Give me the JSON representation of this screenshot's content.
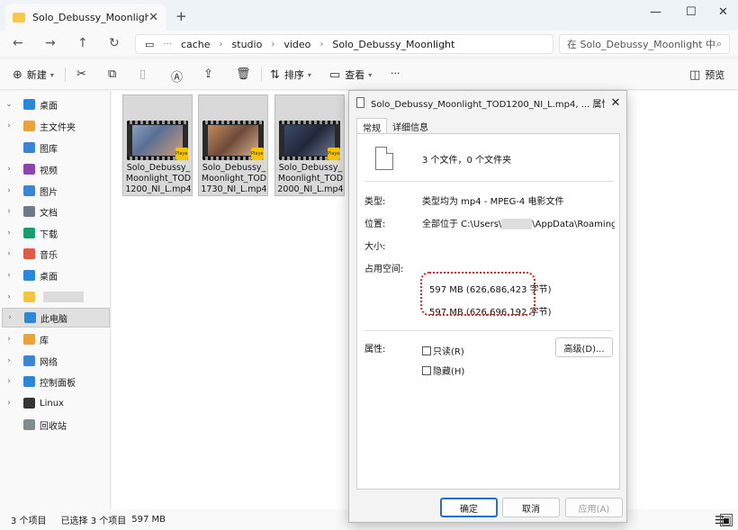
{
  "tab": {
    "title": "Solo_Debussy_Moonlight",
    "close": "✕",
    "new_tab": "+"
  },
  "window_controls": {
    "minimize": "—",
    "maximize": "☐",
    "close": "✕"
  },
  "address": {
    "back": "←",
    "forward": "→",
    "up": "↑",
    "refresh": "↻",
    "more": "···",
    "breadcrumbs": [
      "cache",
      "studio",
      "video",
      "Solo_Debussy_Moonlight"
    ],
    "search_placeholder": "在 Solo_Debussy_Moonlight 中搜索"
  },
  "toolbar": {
    "new": "新建",
    "sort": "排序",
    "view": "查看",
    "more": "···",
    "preview": "预览"
  },
  "sidebar": {
    "items": [
      {
        "label": "桌面",
        "expand": "⌄",
        "color": "#2b88d8"
      },
      {
        "label": "主文件夹",
        "expand": "›",
        "color": "#e8a33d"
      },
      {
        "label": "图库",
        "expand": "",
        "color": "#3a86d4"
      },
      {
        "label": "视频",
        "expand": "›",
        "color": "#8e44ad"
      },
      {
        "label": "图片",
        "expand": "›",
        "color": "#3a86d4"
      },
      {
        "label": "文档",
        "expand": "›",
        "color": "#6c7a89"
      },
      {
        "label": "下载",
        "expand": "›",
        "color": "#1a9c6e"
      },
      {
        "label": "音乐",
        "expand": "›",
        "color": "#e05a47"
      },
      {
        "label": "桌面",
        "expand": "›",
        "color": "#2b88d8"
      },
      {
        "label": "",
        "expand": "›",
        "color": "#f5c542"
      },
      {
        "label": "此电脑",
        "expand": "›",
        "color": "#2b88d8"
      },
      {
        "label": "库",
        "expand": "›",
        "color": "#e8a33d"
      },
      {
        "label": "网络",
        "expand": "›",
        "color": "#3a86d4"
      },
      {
        "label": "控制面板",
        "expand": "›",
        "color": "#2b88d8"
      },
      {
        "label": "Linux",
        "expand": "›",
        "color": "#333333"
      },
      {
        "label": "回收站",
        "expand": "",
        "color": "#7f8c8d"
      }
    ]
  },
  "files": [
    {
      "name": "Solo_Debussy_Moonlight_TOD1200_NI_L.mp4",
      "badge": "Player"
    },
    {
      "name": "Solo_Debussy_Moonlight_TOD1730_NI_L.mp4",
      "badge": "Player"
    },
    {
      "name": "Solo_Debussy_Moonlight_TOD2000_NI_L.mp4",
      "badge": "Player"
    }
  ],
  "status": {
    "count": "3 个项目",
    "selected": "已选择 3 个项目",
    "size": "597 MB"
  },
  "dialog": {
    "title": "Solo_Debussy_Moonlight_TOD1200_NI_L.mp4, ... 属性",
    "tabs": [
      "常规",
      "详细信息"
    ],
    "summary": "3 个文件，0 个文件夹",
    "type_label": "类型:",
    "type_value": "类型均为 mp4 - MPEG-4 电影文件",
    "location_label": "位置:",
    "location_prefix": "全部位于  C:\\Users\\",
    "location_suffix": "\\AppData\\Roaming\\miH",
    "size_label": "大小:",
    "size_value": "597 MB (626,686,423 字节)",
    "disk_label": "占用空间:",
    "disk_value": "597 MB (626,696,192 字节)",
    "attr_label": "属性:",
    "readonly": "只读(R)",
    "hidden": "隐藏(H)",
    "advanced": "高级(D)...",
    "ok": "确定",
    "cancel": "取消",
    "apply": "应用(A)"
  }
}
